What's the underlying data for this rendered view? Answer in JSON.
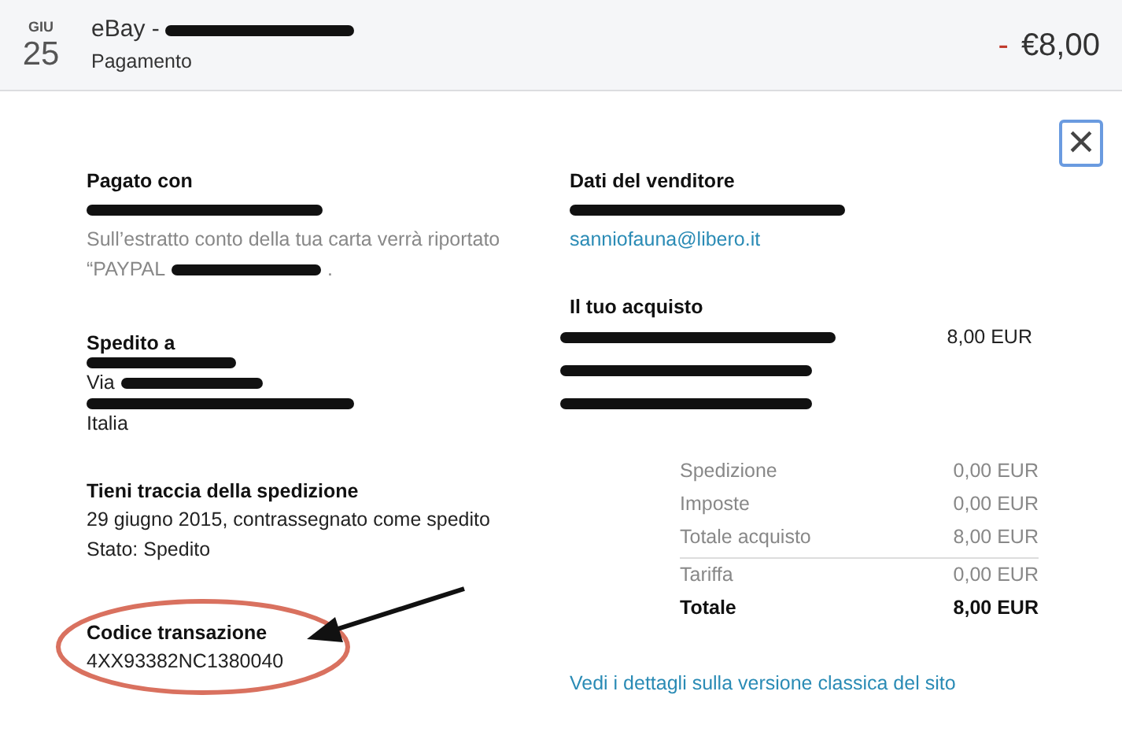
{
  "header": {
    "month": "GIU",
    "day": "25",
    "title": "eBay -",
    "title_redacted": true,
    "subtitle": "Pagamento",
    "sign": "-",
    "amount": "€8,00"
  },
  "close_button": {
    "label": "×"
  },
  "paid_with": {
    "heading": "Pagato con",
    "account_redacted": true,
    "note": "Sull’estratto conto della tua carta verrà riportato",
    "statement_prefix": "“PAYPAL",
    "statement_redacted": true,
    "statement_suffix": "."
  },
  "shipped_to": {
    "heading": "Spedito a",
    "lines": [
      {
        "redacted": true
      },
      {
        "text": "Via",
        "redacted": true
      },
      {
        "redacted": true
      },
      {
        "text": "Italia",
        "redacted": false
      }
    ]
  },
  "tracking": {
    "heading": "Tieni traccia della spedizione",
    "lines": [
      "29 giugno 2015, contrassegnato come spedito",
      "Stato: Spedito"
    ]
  },
  "transaction": {
    "heading": "Codice transazione",
    "code": "4XX93382NC1380040",
    "circled": true
  },
  "seller": {
    "heading": "Dati del venditore",
    "name_redacted": true,
    "email": "sanniofauna@libero.it"
  },
  "purchase": {
    "heading": "Il tuo acquisto",
    "items": [
      {
        "redacted": true,
        "price": "8,00 EUR"
      },
      {
        "redacted": true
      },
      {
        "redacted": true
      }
    ]
  },
  "summary": [
    {
      "label": "Spedizione",
      "value": "0,00 EUR",
      "kind": "normal"
    },
    {
      "label": "Imposte",
      "value": "0,00 EUR",
      "kind": "normal"
    },
    {
      "label": "Totale acquisto",
      "value": "8,00 EUR",
      "kind": "normal"
    },
    {
      "label": "Tariffa",
      "value": "0,00 EUR",
      "kind": "divided"
    },
    {
      "label": "Totale",
      "value": "8,00 EUR",
      "kind": "total"
    }
  ],
  "classic_link": "Vedi i dettagli sulla versione classica del sito"
}
